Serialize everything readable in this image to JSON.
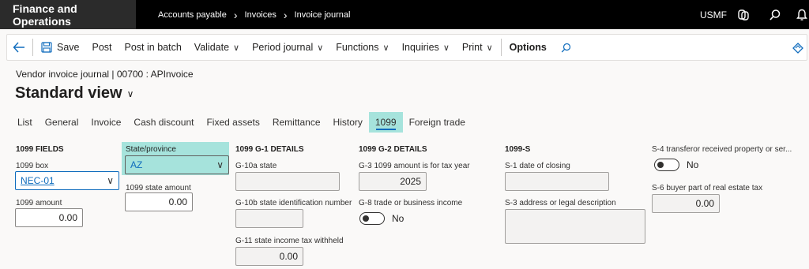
{
  "topbar": {
    "app_name": "Finance and Operations",
    "breadcrumbs": [
      "Accounts payable",
      "Invoices",
      "Invoice journal"
    ],
    "company": "USMF"
  },
  "actions": {
    "save": "Save",
    "post": "Post",
    "post_in_batch": "Post in batch",
    "validate": "Validate",
    "period_journal": "Period journal",
    "functions": "Functions",
    "inquiries": "Inquiries",
    "print": "Print",
    "options": "Options"
  },
  "header": {
    "caption": "Vendor invoice journal  |  00700 : APInvoice",
    "view_name": "Standard view"
  },
  "tabs": [
    "List",
    "General",
    "Invoice",
    "Cash discount",
    "Fixed assets",
    "Remittance",
    "History",
    "1099",
    "Foreign trade"
  ],
  "active_tab": "1099",
  "fields_1099": {
    "title": "1099 FIELDS",
    "box_label": "1099 box",
    "box_value": "NEC-01",
    "amount_label": "1099 amount",
    "amount_value": "0.00"
  },
  "state": {
    "state_label": "State/province",
    "state_value": "AZ",
    "state_amount_label": "1099 state amount",
    "state_amount_value": "0.00"
  },
  "g1": {
    "title": "1099 G-1 DETAILS",
    "g10a_label": "G-10a state",
    "g10a_value": "",
    "g10b_label": "G-10b state identification number",
    "g10b_value": "",
    "g11_label": "G-11 state income tax withheld",
    "g11_value": "0.00"
  },
  "g2": {
    "title": "1099 G-2 DETAILS",
    "g3_label": "G-3 1099 amount is for tax year",
    "g3_value": "2025",
    "g8_label": "G-8 trade or business income",
    "g8_value": "No"
  },
  "s": {
    "title": "1099-S",
    "s1_label": "S-1 date of closing",
    "s1_value": "",
    "s3_label": "S-3 address or legal description",
    "s3_value": ""
  },
  "s4": {
    "s4_label": "S-4 transferor received property or ser...",
    "s4_value": "No",
    "s6_label": "S-6 buyer part of real estate tax",
    "s6_value": "0.00"
  }
}
